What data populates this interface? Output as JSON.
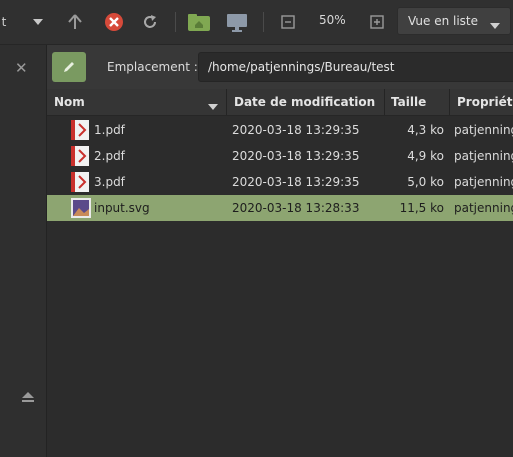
{
  "toolbar": {
    "partial_label": "t",
    "zoom": "50%",
    "view_mode": "Vue en liste",
    "icons": [
      "chevron-down-icon",
      "up-arrow-icon",
      "stop-icon",
      "reload-icon",
      "home-folder-icon",
      "computer-icon",
      "zoom-out-icon",
      "zoom-in-icon"
    ]
  },
  "location": {
    "label": "Emplacement :",
    "path": "/home/patjennings/Bureau/test"
  },
  "columns": {
    "name": "Nom",
    "modified": "Date de modification",
    "size": "Taille",
    "owner": "Propriéta"
  },
  "files": [
    {
      "name": "1.pdf",
      "modified": "2020-03-18 13:29:35",
      "size": "4,3 ko",
      "owner": "patjenning",
      "type": "pdf"
    },
    {
      "name": "2.pdf",
      "modified": "2020-03-18 13:29:35",
      "size": "4,9 ko",
      "owner": "patjenning",
      "type": "pdf"
    },
    {
      "name": "3.pdf",
      "modified": "2020-03-18 13:29:35",
      "size": "5,0 ko",
      "owner": "patjenning",
      "type": "pdf"
    },
    {
      "name": "input.svg",
      "modified": "2020-03-18 13:28:33",
      "size": "11,5 ko",
      "owner": "patjenning",
      "type": "svg"
    }
  ],
  "colors": {
    "accent": "#8da571",
    "edit_button": "#7a9a61",
    "stop_red": "#d64a3a"
  }
}
